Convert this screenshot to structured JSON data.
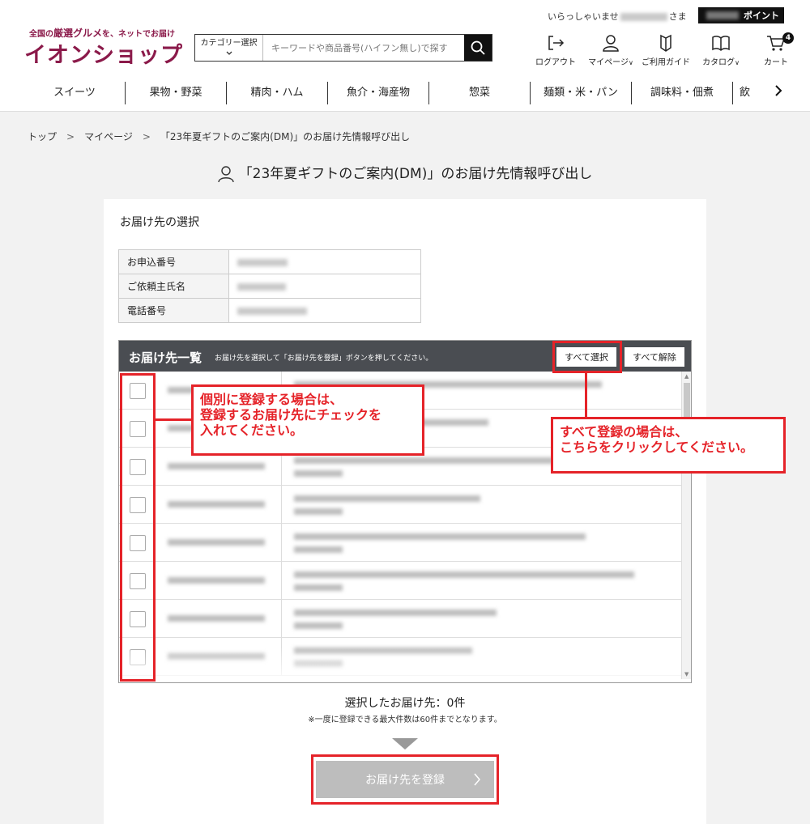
{
  "header": {
    "tagline_pre": "全国の",
    "tagline_hl": "厳選グルメ",
    "tagline_post": "を、ネットでお届け",
    "logo": "イオンショップ",
    "welcome_prefix": "いらっしゃいませ",
    "welcome_suffix": "さま",
    "points_label": "ポイント",
    "search": {
      "category_label": "カテゴリー選択",
      "placeholder": "キーワードや商品番号(ハイフン無し)で探す"
    },
    "icons": [
      {
        "label": "ログアウト",
        "icon": "logout-icon"
      },
      {
        "label": "マイページ",
        "icon": "user-icon"
      },
      {
        "label": "ご利用ガイド",
        "icon": "guide-icon"
      },
      {
        "label": "カタログ",
        "icon": "catalog-icon"
      },
      {
        "label": "カート",
        "icon": "cart-icon",
        "badge": "4"
      }
    ],
    "categories": [
      "スイーツ",
      "果物・野菜",
      "精肉・ハム",
      "魚介・海産物",
      "惣菜",
      "麺類・米・パン",
      "調味料・佃煮",
      "飲"
    ]
  },
  "breadcrumb": [
    "トップ",
    "マイページ",
    "「23年夏ギフトのご案内(DM)」のお届け先情報呼び出し"
  ],
  "page_title": "「23年夏ギフトのご案内(DM)」のお届け先情報呼び出し",
  "card": {
    "title": "お届け先の選択",
    "info": [
      {
        "label": "お申込番号"
      },
      {
        "label": "ご依頼主氏名"
      },
      {
        "label": "電話番号"
      }
    ],
    "list": {
      "title": "お届け先一覧",
      "description": "お届け先を選択して「お届け先を登録」ボタンを押してください。",
      "select_all": "すべて選択",
      "deselect_all": "すべて解除",
      "row_count": 8
    },
    "selected_count": "選択したお届け先：0件",
    "note": "※一度に登録できる最大件数は60件までとなります。",
    "register_button": "お届け先を登録"
  },
  "annotations": {
    "individual": "個別に登録する場合は、\n登録するお届け先にチェックを\n入れてください。",
    "all": "すべて登録の場合は、\nこちらをクリックしてください。"
  },
  "colors": {
    "brand": "#8b1a4a",
    "annotation_red": "#e52329",
    "list_header": "#4a4d52"
  }
}
